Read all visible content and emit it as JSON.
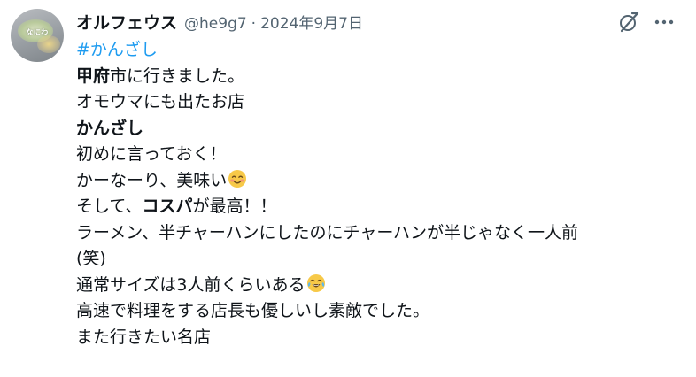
{
  "author": {
    "name": "オルフェウス",
    "handle": "@he9g7",
    "separator": "·",
    "date": "2024年9月7日",
    "avatar_text": "なにわ"
  },
  "icons": {
    "grok": "grok-icon",
    "more": "more-icon",
    "smile_emoji": "smiling-face-emoji",
    "tears_emoji": "tears-of-joy-emoji"
  },
  "colors": {
    "text": "#0f1419",
    "secondary": "#536471",
    "link": "#1d9bf0"
  },
  "post": {
    "hashtag": "#かんざし",
    "line1_bold": "甲府",
    "line1_rest": "市に行きました。",
    "line2": "オモウマにも出たお店",
    "line3_bold": "かんざし",
    "line4": "初めに言っておく！",
    "line5": "かーなーり、美味い",
    "line6_pre": "そして、",
    "line6_bold": "コスパ",
    "line6_post": "が最高！！",
    "line7": "ラーメン、半チャーハンにしたのにチャーハンが半じゃなく一人前",
    "line8": "(笑)",
    "line9": "通常サイズは3人前くらいある",
    "line10": "高速で料理をする店長も優しいし素敵でした。",
    "line11": "また行きたい名店"
  }
}
